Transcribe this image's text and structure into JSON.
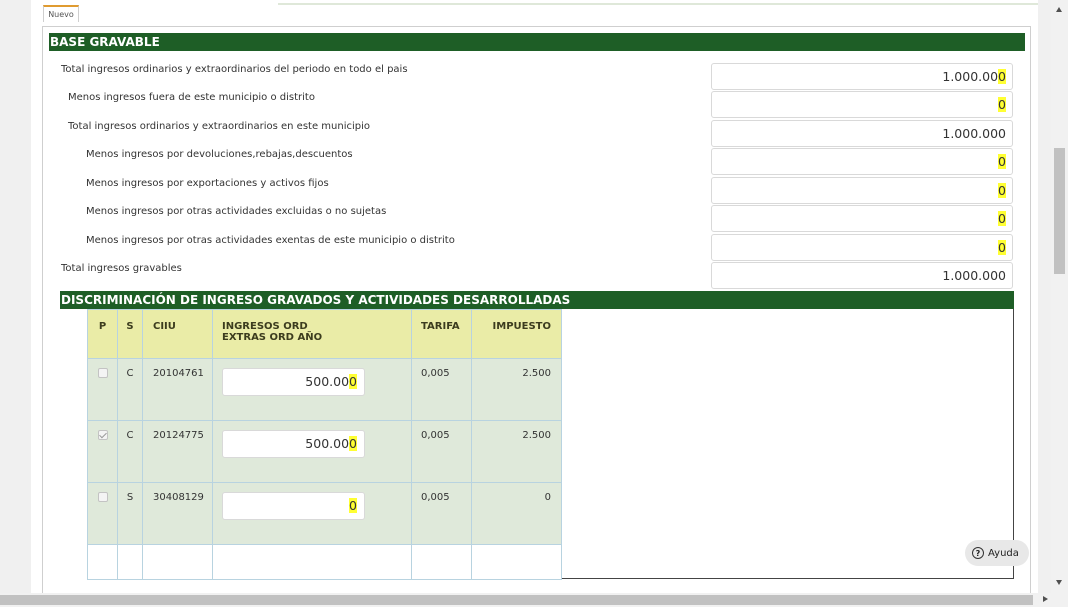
{
  "tab": {
    "label": "Nuevo"
  },
  "base_gravable": {
    "title": "BASE GRAVABLE",
    "rows": [
      {
        "label": "Total ingresos ordinarios y extraordinarios del periodo en todo el pais",
        "value_main": "1.000.00",
        "value_hl": "0"
      },
      {
        "label": "Menos ingresos fuera de este municipio o distrito",
        "value_main": "",
        "value_hl": "0"
      },
      {
        "label": "Total ingresos ordinarios y extraordinarios en este municipio",
        "value_main": "1.000.000",
        "value_hl": ""
      },
      {
        "label": "Menos ingresos por devoluciones,rebajas,descuentos",
        "value_main": "",
        "value_hl": "0"
      },
      {
        "label": "Menos ingresos por exportaciones y activos fijos",
        "value_main": "",
        "value_hl": "0"
      },
      {
        "label": "Menos ingresos por otras actividades excluidas o no sujetas",
        "value_main": "",
        "value_hl": "0"
      },
      {
        "label": "Menos ingresos por otras actividades exentas de este municipio o distrito",
        "value_main": "",
        "value_hl": "0"
      },
      {
        "label": "Total ingresos gravables",
        "value_main": "1.000.000",
        "value_hl": ""
      }
    ]
  },
  "discriminacion": {
    "title": "DISCRIMINACIÓN DE INGRESO GRAVADOS Y ACTIVIDADES DESARROLLADAS",
    "headers": {
      "p": "P",
      "s": "S",
      "ciiu": "CIIU",
      "ingresos_line1": "INGRESOS ORD",
      "ingresos_line2": "EXTRAS ORD AÑO",
      "tarifa": "TARIFA",
      "impuesto": "IMPUESTO"
    },
    "rows": [
      {
        "checked": false,
        "s": "C",
        "ciiu": "20104761",
        "ingresos_main": "500.00",
        "ingresos_hl": "0",
        "tarifa": "0,005",
        "impuesto": "2.500"
      },
      {
        "checked": true,
        "s": "C",
        "ciiu": "20124775",
        "ingresos_main": "500.00",
        "ingresos_hl": "0",
        "tarifa": "0,005",
        "impuesto": "2.500"
      },
      {
        "checked": false,
        "s": "S",
        "ciiu": "30408129",
        "ingresos_main": "",
        "ingresos_hl": "0",
        "tarifa": "0,005",
        "impuesto": "0"
      }
    ]
  },
  "help": {
    "label": "Ayuda",
    "icon": "question-circle-icon"
  }
}
